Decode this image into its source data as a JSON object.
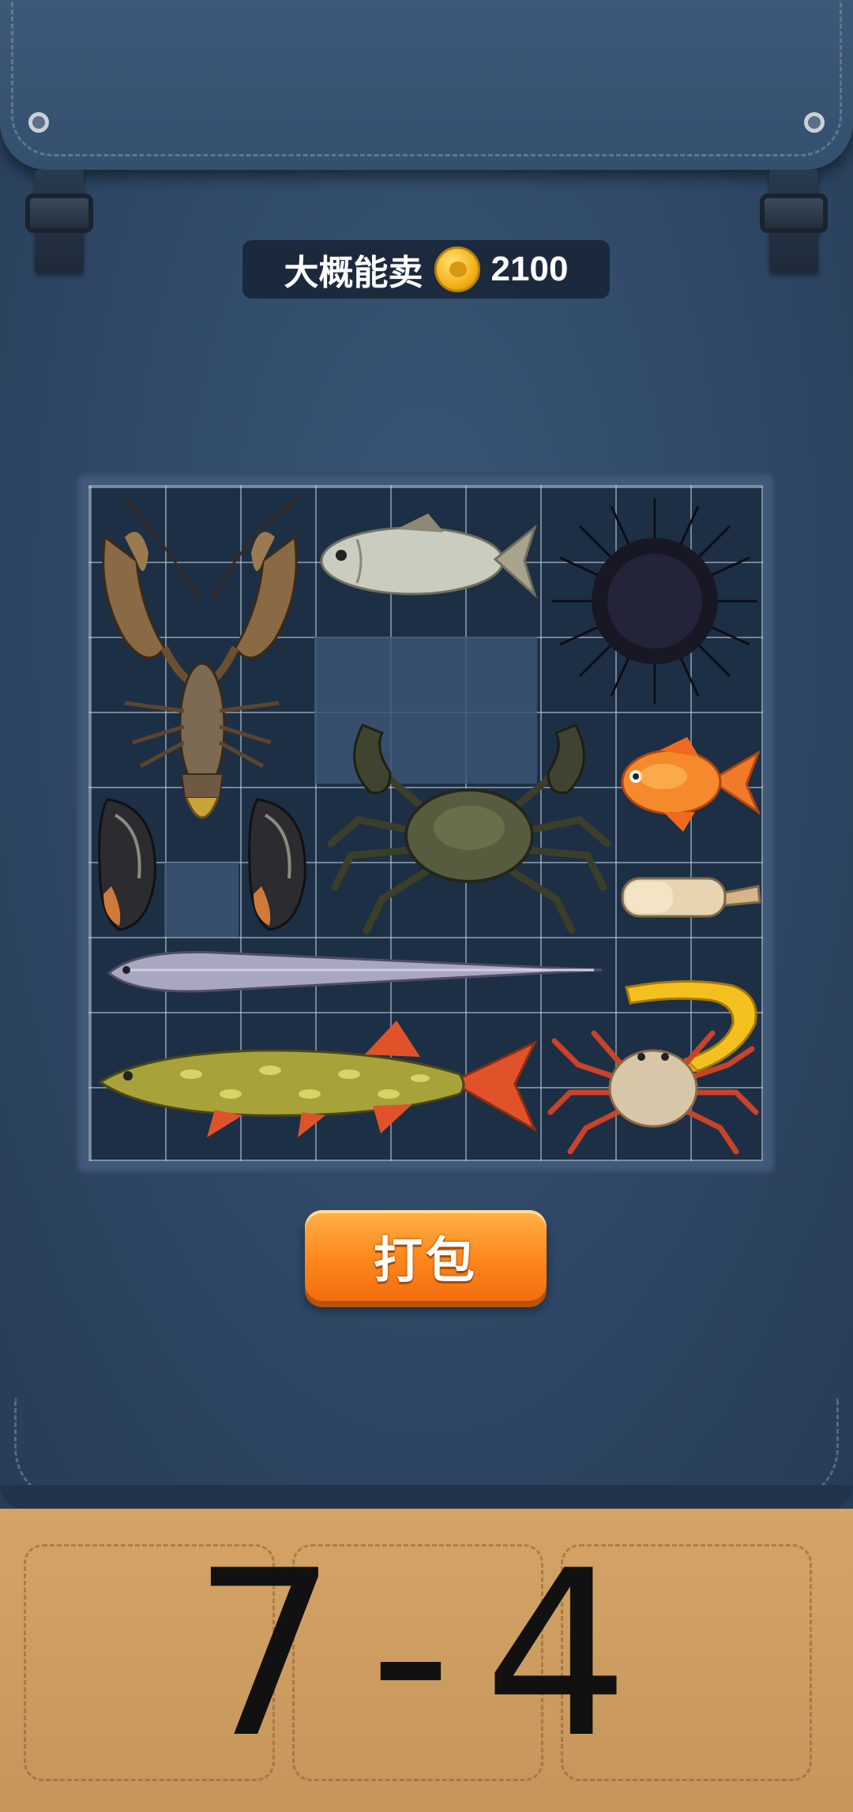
{
  "header": {
    "price_label": "大概能卖",
    "coin_icon": "gold-coin-icon",
    "price_value": "2100"
  },
  "backpack": {
    "items": [
      {
        "name": "crayfish"
      },
      {
        "name": "white-fish"
      },
      {
        "name": "sea-urchin"
      },
      {
        "name": "mussel"
      },
      {
        "name": "mussel"
      },
      {
        "name": "river-crab"
      },
      {
        "name": "goldfish"
      },
      {
        "name": "razor-clam"
      },
      {
        "name": "eel"
      },
      {
        "name": "banana-shrimp"
      },
      {
        "name": "pike"
      },
      {
        "name": "red-crab"
      }
    ]
  },
  "actions": {
    "pack_label": "打包"
  },
  "level": {
    "label": "7-4"
  },
  "colors": {
    "bag": "#2f4866",
    "grid": "#1d2f44",
    "button": "#ff8a1f",
    "tray": "#d4a466"
  }
}
